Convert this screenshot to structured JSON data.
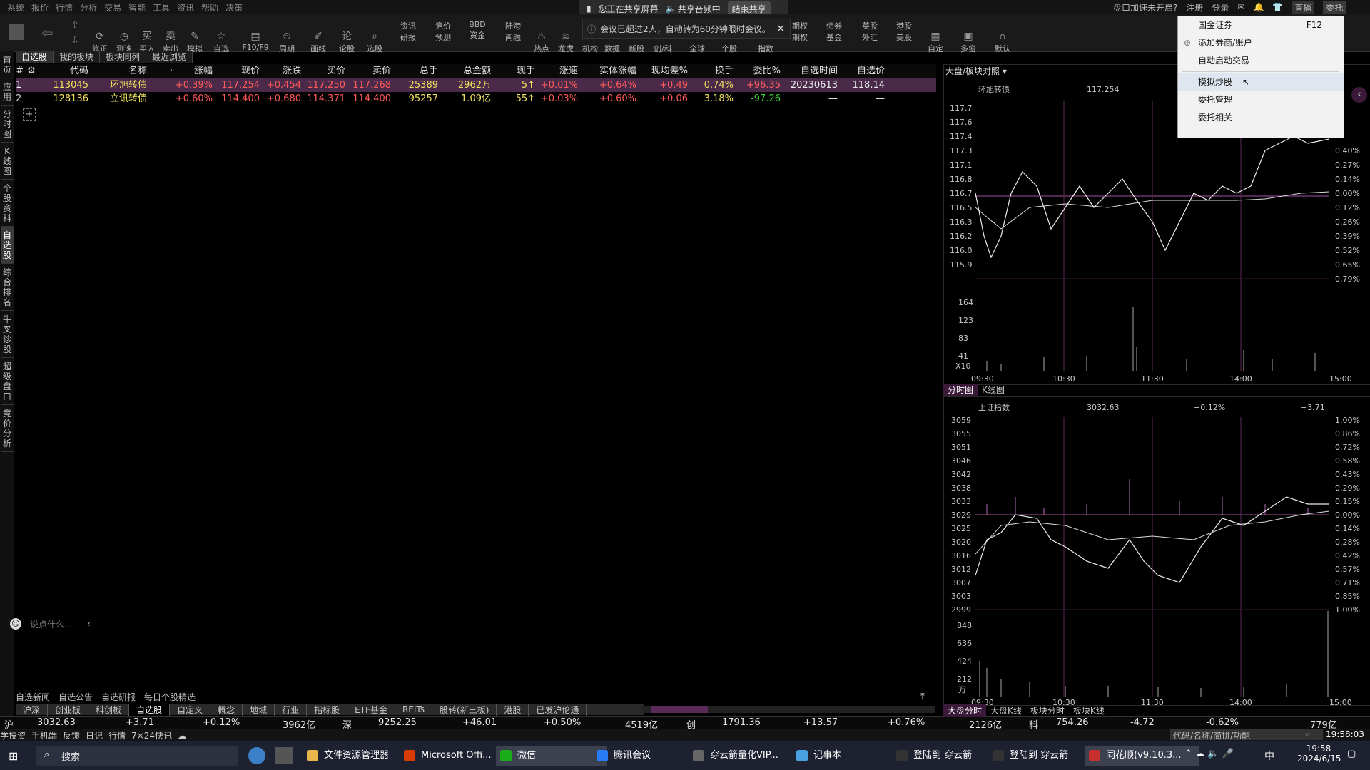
{
  "menubar": {
    "items": [
      "系统",
      "报价",
      "行情",
      "分析",
      "交易",
      "智能",
      "工具",
      "资讯",
      "帮助",
      "决策"
    ]
  },
  "share": {
    "status": "您正在共享屏幕",
    "audio": "共享音频中",
    "end": "结束共享"
  },
  "top_right": {
    "speed": "盘口加速未开启?",
    "register": "注册",
    "login": "登录",
    "direct": "直播",
    "entrust": "委托"
  },
  "toolbar": {
    "items": [
      "修正",
      "测速",
      "买入",
      "卖出",
      "模拟",
      "自选",
      "F10/F9",
      "周期",
      "画线",
      "论股",
      "选股",
      "研报",
      "预测",
      "资金",
      "两融",
      "热点",
      "龙虎",
      "机构",
      "数据",
      "新股",
      "创/科",
      "全球",
      "个股",
      "指数",
      "期权",
      "基金",
      "外汇",
      "美股",
      "自定",
      "多窗",
      "默认"
    ],
    "top_items": [
      "资讯",
      "竞价",
      "BBD",
      "陆港",
      "期权",
      "债券",
      "英股",
      "港股"
    ],
    "notice": "会议已超过2人，自动转为60分钟限时会议。"
  },
  "left_tabs": [
    "首页",
    "应用",
    "分时图",
    "K线图",
    "个股资料",
    "自选股",
    "综合排名",
    "牛叉诊股",
    "超级盘口",
    "竞价分析"
  ],
  "subtabs": [
    "自选股",
    "我的板块",
    "板块同列",
    "最近浏览"
  ],
  "table": {
    "headers": [
      "#",
      "代码",
      "名称",
      "·",
      "涨幅",
      "现价",
      "涨跌",
      "买价",
      "卖价",
      "总手",
      "总金额",
      "现手",
      "涨速",
      "实体涨幅",
      "现均差%",
      "换手",
      "委比%",
      "自选时间",
      "自选价"
    ],
    "rows": [
      [
        "1",
        "113045",
        "环旭转债",
        "",
        "+0.39%",
        "117.254",
        "+0.454",
        "117.250",
        "117.268",
        "25389",
        "2962万",
        "5↑",
        "+0.01%",
        "+0.64%",
        "+0.49",
        "0.74%",
        "+96.35",
        "20230613",
        "118.14"
      ],
      [
        "2",
        "128136",
        "立讯转债",
        "",
        "+0.60%",
        "114.400",
        "+0.680",
        "114.371",
        "114.400",
        "95257",
        "1.09亿",
        "55↑",
        "+0.03%",
        "+0.60%",
        "+0.06",
        "3.18%",
        "-97.26",
        "—",
        "—"
      ]
    ]
  },
  "chat": {
    "placeholder": "说点什么..."
  },
  "bottom_news": [
    "自选新闻",
    "自选公告",
    "自选研报",
    "每日个股精选"
  ],
  "sheet_tabs": [
    "沪深",
    "创业板",
    "科创板",
    "自选股",
    "自定义",
    "概念",
    "地域",
    "行业",
    "指标股",
    "ETF基金",
    "REITs",
    "股转(新三板)",
    "港股",
    "已发沪伦通"
  ],
  "index_bar": {
    "sh": {
      "label": "沪",
      "value": "3032.63",
      "change": "+3.71",
      "pct": "+0.12%",
      "amount": "3962亿"
    },
    "sz": {
      "label": "深",
      "value": "9252.25",
      "change": "+46.01",
      "pct": "+0.50%",
      "amount": "4519亿"
    },
    "cy": {
      "label": "创",
      "value": "1791.36",
      "change": "+13.57",
      "pct": "+0.76%",
      "amount": "2126亿"
    },
    "kc": {
      "label": "科",
      "value": "754.26",
      "change": "-4.72",
      "pct": "-0.62%",
      "amount": "779亿"
    }
  },
  "status_bar": {
    "items": [
      "学投资",
      "手机端",
      "反馈",
      "日记",
      "行情",
      "7×24快讯"
    ],
    "search": "代码/名称/简拼/功能",
    "time": "19:58:03"
  },
  "chart_top": {
    "header": "大盘/板块对照",
    "title": "环旭转债",
    "price": "117.254",
    "y_left": [
      "117.7",
      "117.6",
      "117.4",
      "117.3",
      "117.1",
      "116.8",
      "116.7",
      "116.5",
      "116.3",
      "116.2",
      "116.0",
      "115.9"
    ],
    "y_right": [
      "0.40%",
      "0.27%",
      "0.14%",
      "0.00%",
      "0.12%",
      "0.26%",
      "0.39%",
      "0.52%",
      "0.65%",
      "0.79%"
    ],
    "vol_labels": [
      "164",
      "123",
      "83",
      "41"
    ],
    "vol_unit": "X10",
    "x_labels": [
      "09:30",
      "10:30",
      "11:30",
      "14:00",
      "15:00"
    ],
    "tabs": [
      "分时图",
      "K线图"
    ]
  },
  "chart_bottom": {
    "title": "上证指数",
    "price": "3032.63",
    "pct": "+0.12%",
    "change": "+3.71",
    "y_left": [
      "3059",
      "3055",
      "3051",
      "3046",
      "3042",
      "3038",
      "3033",
      "3029",
      "3025",
      "3020",
      "3016",
      "3012",
      "3007",
      "3003",
      "2999"
    ],
    "y_right": [
      "1.00%",
      "0.86%",
      "0.72%",
      "0.58%",
      "0.43%",
      "0.29%",
      "0.15%",
      "0.00%",
      "0.14%",
      "0.28%",
      "0.42%",
      "0.57%",
      "0.71%",
      "0.85%",
      "1.00%"
    ],
    "vol_labels": [
      "848",
      "636",
      "424",
      "212"
    ],
    "vol_unit": "万",
    "x_labels": [
      "09:30",
      "10:30",
      "11:30",
      "14:00",
      "15:00"
    ],
    "tabs": [
      "大盘分时",
      "大盘K线",
      "板块分时",
      "板块K线"
    ]
  },
  "popup": {
    "items": [
      {
        "label": "国金证券",
        "key": "F12"
      },
      {
        "label": "添加券商/账户",
        "key": ""
      },
      {
        "label": "自动启动交易",
        "key": ""
      },
      {
        "label": "模拟炒股",
        "key": ""
      },
      {
        "label": "委托管理",
        "key": ""
      },
      {
        "label": "委托相关",
        "key": ""
      }
    ]
  },
  "taskbar": {
    "search": "搜索",
    "apps": [
      "文件资源管理器",
      "Microsoft Offi...",
      "微信",
      "腾讯会议",
      "穿云箭量化VIP...",
      "记事本",
      "登陆到 穿云箭",
      "登陆到 穿云箭",
      "同花顺(v9.10.3..."
    ],
    "ime": "中",
    "time": "19:58",
    "date": "2024/6/15"
  }
}
